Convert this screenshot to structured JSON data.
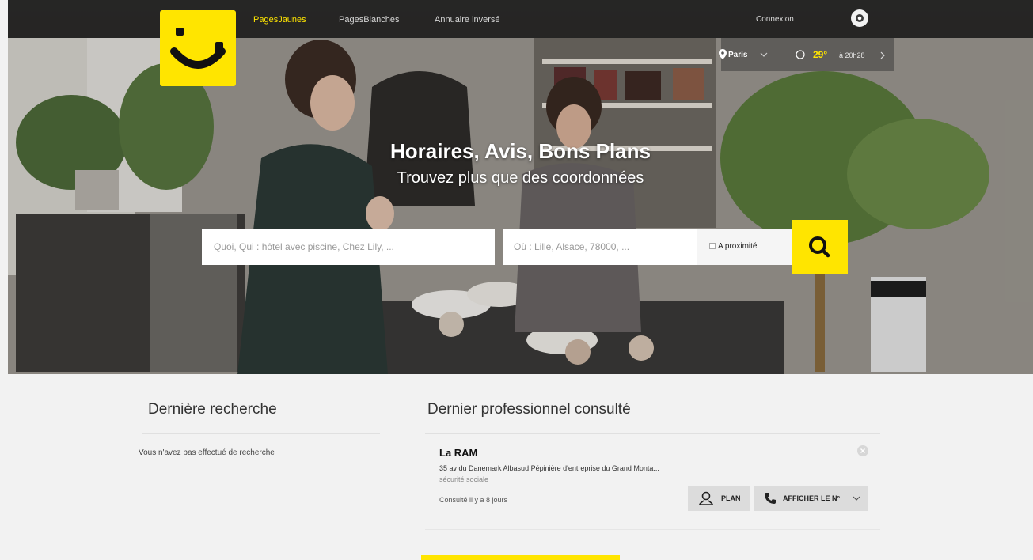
{
  "nav": {
    "links": [
      "PagesJaunes",
      "PagesBlanches",
      "Annuaire inversé"
    ],
    "connexion": "Connexion"
  },
  "weather": {
    "city": "Paris",
    "temperature": "29°",
    "time": "à 20h28"
  },
  "hero": {
    "title": "Horaires, Avis, Bons Plans",
    "subtitle": "Trouvez plus que des coordonnées"
  },
  "search": {
    "what_placeholder": "Quoi, Qui : hôtel avec piscine, Chez Lily, ...",
    "where_placeholder": "Où : Lille, Alsace, 78000, ...",
    "proximity_label": "A proximité"
  },
  "last_search": {
    "title": "Dernière recherche",
    "empty_text": "Vous n'avez pas effectué de recherche"
  },
  "last_pro": {
    "title": "Dernier professionnel consulté",
    "name": "La RAM",
    "address": "35 av du Danemark Albasud Pépinière d'entreprise du Grand Monta...",
    "category": "sécurité sociale",
    "consulted": "Consulté il y a 8 jours",
    "plan_label": "PLAN",
    "phone_label": "AFFICHER LE N°"
  },
  "colors": {
    "brand_yellow": "#ffe500",
    "topbar": "#141414"
  }
}
